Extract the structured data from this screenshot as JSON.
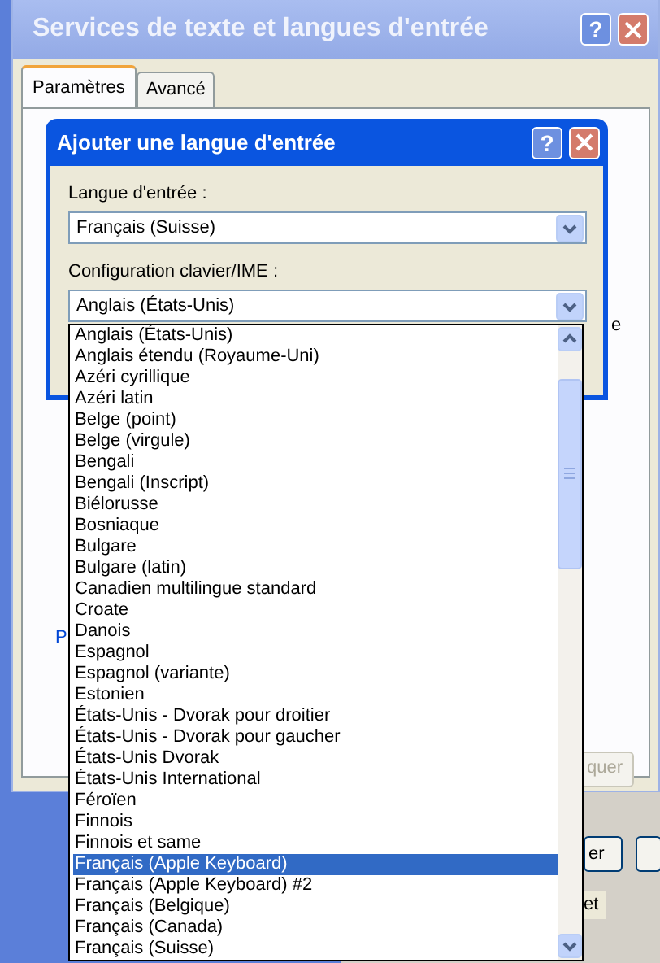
{
  "window": {
    "title": "Services de texte et langues d'entrée",
    "title_buttons": [
      "?"
    ],
    "tabs": [
      {
        "label": "Paramètres",
        "selected": true
      },
      {
        "label": "Avancé",
        "selected": false
      }
    ],
    "fragments": [
      {
        "kind": "label",
        "text": "P"
      },
      {
        "kind": "text",
        "text": "e"
      },
      {
        "kind": "button",
        "text": "quer",
        "disabled": true
      }
    ]
  },
  "behind_window": {
    "fragments": [
      {
        "kind": "button",
        "text": "er"
      },
      {
        "kind": "button"
      },
      {
        "kind": "text",
        "text": "et"
      }
    ]
  },
  "dialog": {
    "title": "Ajouter une langue d'entrée",
    "title_buttons": [
      "?"
    ],
    "fields": [
      {
        "label": "Langue d'entrée :",
        "value": "Français (Suisse)"
      },
      {
        "label": "Configuration clavier/IME :",
        "value": "Anglais (États-Unis)"
      }
    ],
    "dropdown": {
      "items": [
        {
          "label": "Anglais (États-Unis)",
          "selected": false
        },
        {
          "label": "Anglais étendu (Royaume-Uni)",
          "selected": false
        },
        {
          "label": "Azéri cyrillique",
          "selected": false
        },
        {
          "label": "Azéri latin",
          "selected": false
        },
        {
          "label": "Belge (point)",
          "selected": false
        },
        {
          "label": "Belge (virgule)",
          "selected": false
        },
        {
          "label": "Bengali",
          "selected": false
        },
        {
          "label": "Bengali (Inscript)",
          "selected": false
        },
        {
          "label": "Biélorusse",
          "selected": false
        },
        {
          "label": "Bosniaque",
          "selected": false
        },
        {
          "label": "Bulgare",
          "selected": false
        },
        {
          "label": "Bulgare (latin)",
          "selected": false
        },
        {
          "label": "Canadien multilingue standard",
          "selected": false
        },
        {
          "label": "Croate",
          "selected": false
        },
        {
          "label": "Danois",
          "selected": false
        },
        {
          "label": "Espagnol",
          "selected": false
        },
        {
          "label": "Espagnol (variante)",
          "selected": false
        },
        {
          "label": "Estonien",
          "selected": false
        },
        {
          "label": "États-Unis - Dvorak pour droitier",
          "selected": false
        },
        {
          "label": "États-Unis - Dvorak pour gaucher",
          "selected": false
        },
        {
          "label": "États-Unis Dvorak",
          "selected": false
        },
        {
          "label": "États-Unis International",
          "selected": false
        },
        {
          "label": "Féroïen",
          "selected": false
        },
        {
          "label": "Finnois",
          "selected": false
        },
        {
          "label": "Finnois et same",
          "selected": false
        },
        {
          "label": "Français (Apple Keyboard)",
          "selected": true
        },
        {
          "label": "Français (Apple Keyboard) #2",
          "selected": false
        },
        {
          "label": "Français (Belgique)",
          "selected": false
        },
        {
          "label": "Français (Canada)",
          "selected": false
        },
        {
          "label": "Français (Suisse)",
          "selected": false
        }
      ]
    }
  }
}
